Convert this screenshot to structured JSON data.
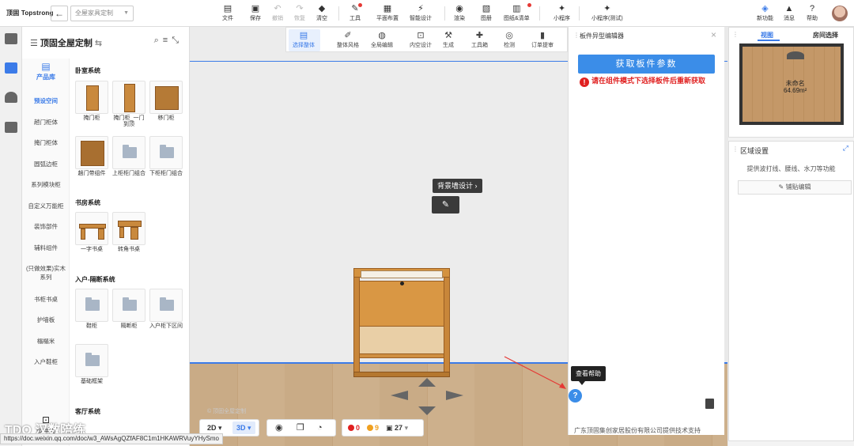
{
  "topbar": {
    "logo": "顶固 Topstrong",
    "doc_select": "全屋家具定制",
    "tools": [
      {
        "icon": "file-icon",
        "label": "文件"
      },
      {
        "icon": "save-icon",
        "label": "保存"
      },
      {
        "icon": "undo-icon",
        "label": "撤销"
      },
      {
        "icon": "redo-icon",
        "label": "恢复"
      },
      {
        "icon": "eraser-icon",
        "label": "清空"
      },
      {
        "icon": "wrench-icon",
        "label": "工具"
      },
      {
        "icon": "floorplan-icon",
        "label": "平面布置"
      },
      {
        "icon": "smart-design-icon",
        "label": "智能设计"
      },
      {
        "icon": "render-icon",
        "label": "渲染"
      },
      {
        "icon": "album-icon",
        "label": "图册"
      },
      {
        "icon": "drawings-icon",
        "label": "图纸&清单"
      },
      {
        "icon": "miniapp-icon",
        "label": "小程序"
      },
      {
        "icon": "miniapp-test-icon",
        "label": "小程序(测试)"
      },
      {
        "icon": "new-feature-icon",
        "label": "新功能"
      },
      {
        "icon": "message-icon",
        "label": "消息"
      },
      {
        "icon": "help-icon",
        "label": "帮助"
      }
    ]
  },
  "panel": {
    "title": "顶固全屋定制",
    "library_label": "产品库",
    "component_lib_label": "组件库",
    "categories": [
      "预设空间",
      "趟门柜体",
      "掩门柜体",
      "圆弧边柜",
      "系列模块柜",
      "自定义万能柜",
      "装饰部件",
      "辅料组件",
      "(只做效果)实木系列",
      "书柜书桌",
      "护墙板",
      "榻榻米",
      "入户鞋柜"
    ],
    "sections": [
      {
        "title": "卧室系统",
        "items": [
          "掩门柜",
          "掩门柜_一门到顶",
          "移门柜",
          "趟门带组件",
          "上柜柜门组合",
          "下柜柜门组合"
        ]
      },
      {
        "title": "书房系统",
        "items": [
          "一字书桌",
          "转角书桌"
        ]
      },
      {
        "title": "入户-隔断系统",
        "items": [
          "鞋柜",
          "隔断柜",
          "入户柜下区间",
          "基础框架"
        ]
      },
      {
        "title": "客厅系统",
        "items": []
      }
    ]
  },
  "subbar": [
    {
      "icon": "select-all-icon",
      "label": "选择整体"
    },
    {
      "icon": "style-icon",
      "label": "整体风格"
    },
    {
      "icon": "global-edit-icon",
      "label": "全局编辑"
    },
    {
      "icon": "inner-design-icon",
      "label": "内空设计"
    },
    {
      "icon": "generate-icon",
      "label": "生成"
    },
    {
      "icon": "toolbox-icon",
      "label": "工具箱"
    },
    {
      "icon": "check-icon",
      "label": "检测"
    },
    {
      "icon": "order-icon",
      "label": "订单提审"
    }
  ],
  "canvas": {
    "wall_label": "背景墙设计",
    "watermark": "© 顶固全屋定制",
    "view_2d": "2D",
    "view_3d": "3D",
    "errors": "0",
    "warnings": "9",
    "count": "27",
    "brand_watermark": "TDO 汉数陪练",
    "url": "https://doc.weixin.qq.com/doc/w3_AWsAgQZfAF8C1m1HKAWRVuyYHySmo"
  },
  "editor": {
    "title": "板件异型编辑器",
    "button": "获取板件参数",
    "warning": "请在组件模式下选择板件后重新获取",
    "tooltip": "查看帮助",
    "footer": "广东顶固集创家居股份有限公司提供技术支持"
  },
  "minimap": {
    "tab_view": "视图",
    "tab_room": "房间选择",
    "room_name": "未命名",
    "room_area": "64.69m²"
  },
  "area": {
    "title": "区域设置",
    "desc": "提供波打线、腰线、水刀等功能",
    "button": "铺贴编辑"
  },
  "colors": {
    "accent": "#3b7be8",
    "warning": "#e02020",
    "wood": "#c9893d"
  }
}
